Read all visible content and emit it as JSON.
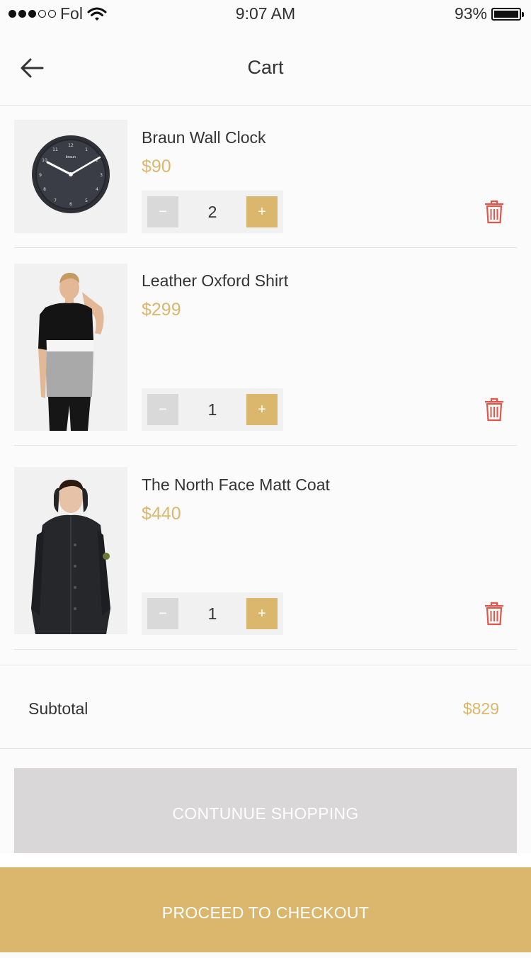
{
  "status_bar": {
    "carrier": "Fol",
    "time": "9:07 AM",
    "battery": "93%",
    "signal_dots_filled": 3,
    "signal_dots_total": 5
  },
  "header": {
    "title": "Cart",
    "back_icon": "arrow-left-icon"
  },
  "items": [
    {
      "name": "Braun Wall Clock",
      "price": "$90",
      "quantity": "2",
      "image": "wall-clock",
      "minus": "−",
      "plus": "+"
    },
    {
      "name": "Leather Oxford Shirt",
      "price": "$299",
      "quantity": "1",
      "image": "man-polo-shirt",
      "minus": "−",
      "plus": "+"
    },
    {
      "name": "The North Face Matt Coat",
      "price": "$440",
      "quantity": "1",
      "image": "man-black-coat",
      "minus": "−",
      "plus": "+"
    }
  ],
  "summary": {
    "subtotal_label": "Subtotal",
    "subtotal_value": "$829"
  },
  "actions": {
    "continue_label": "CONTUNUE SHOPPING",
    "checkout_label": "PROCEED TO CHECKOUT"
  },
  "colors": {
    "accent": "#dbb76d",
    "delete": "#e0564a",
    "muted_button": "#d9d7d8"
  }
}
